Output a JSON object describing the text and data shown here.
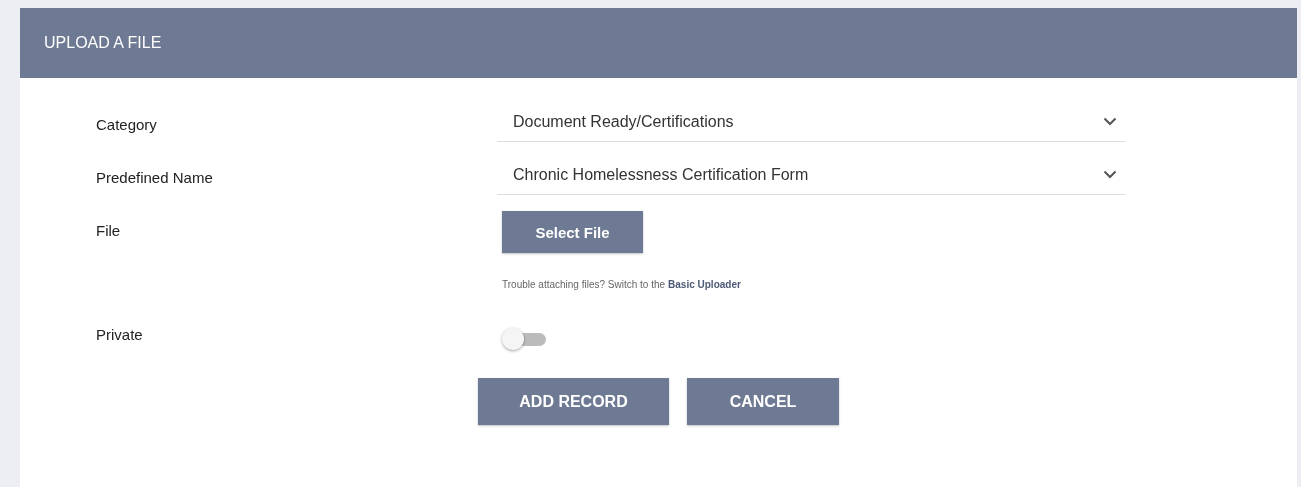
{
  "title": "UPLOAD A FILE",
  "fields": [
    {
      "kind": "select",
      "label": "Category",
      "value": "Document Ready/Certifications"
    },
    {
      "kind": "select",
      "label": "Predefined Name",
      "value": "Chronic Homelessness Certification Form"
    },
    {
      "kind": "file",
      "label": "File",
      "button": "Select File",
      "hint": "Trouble attaching files? Switch to the",
      "link": "Basic Uploader"
    },
    {
      "kind": "toggle",
      "label": "Private",
      "on": false
    }
  ],
  "buttons": [
    "ADD RECORD",
    "CANCEL"
  ]
}
